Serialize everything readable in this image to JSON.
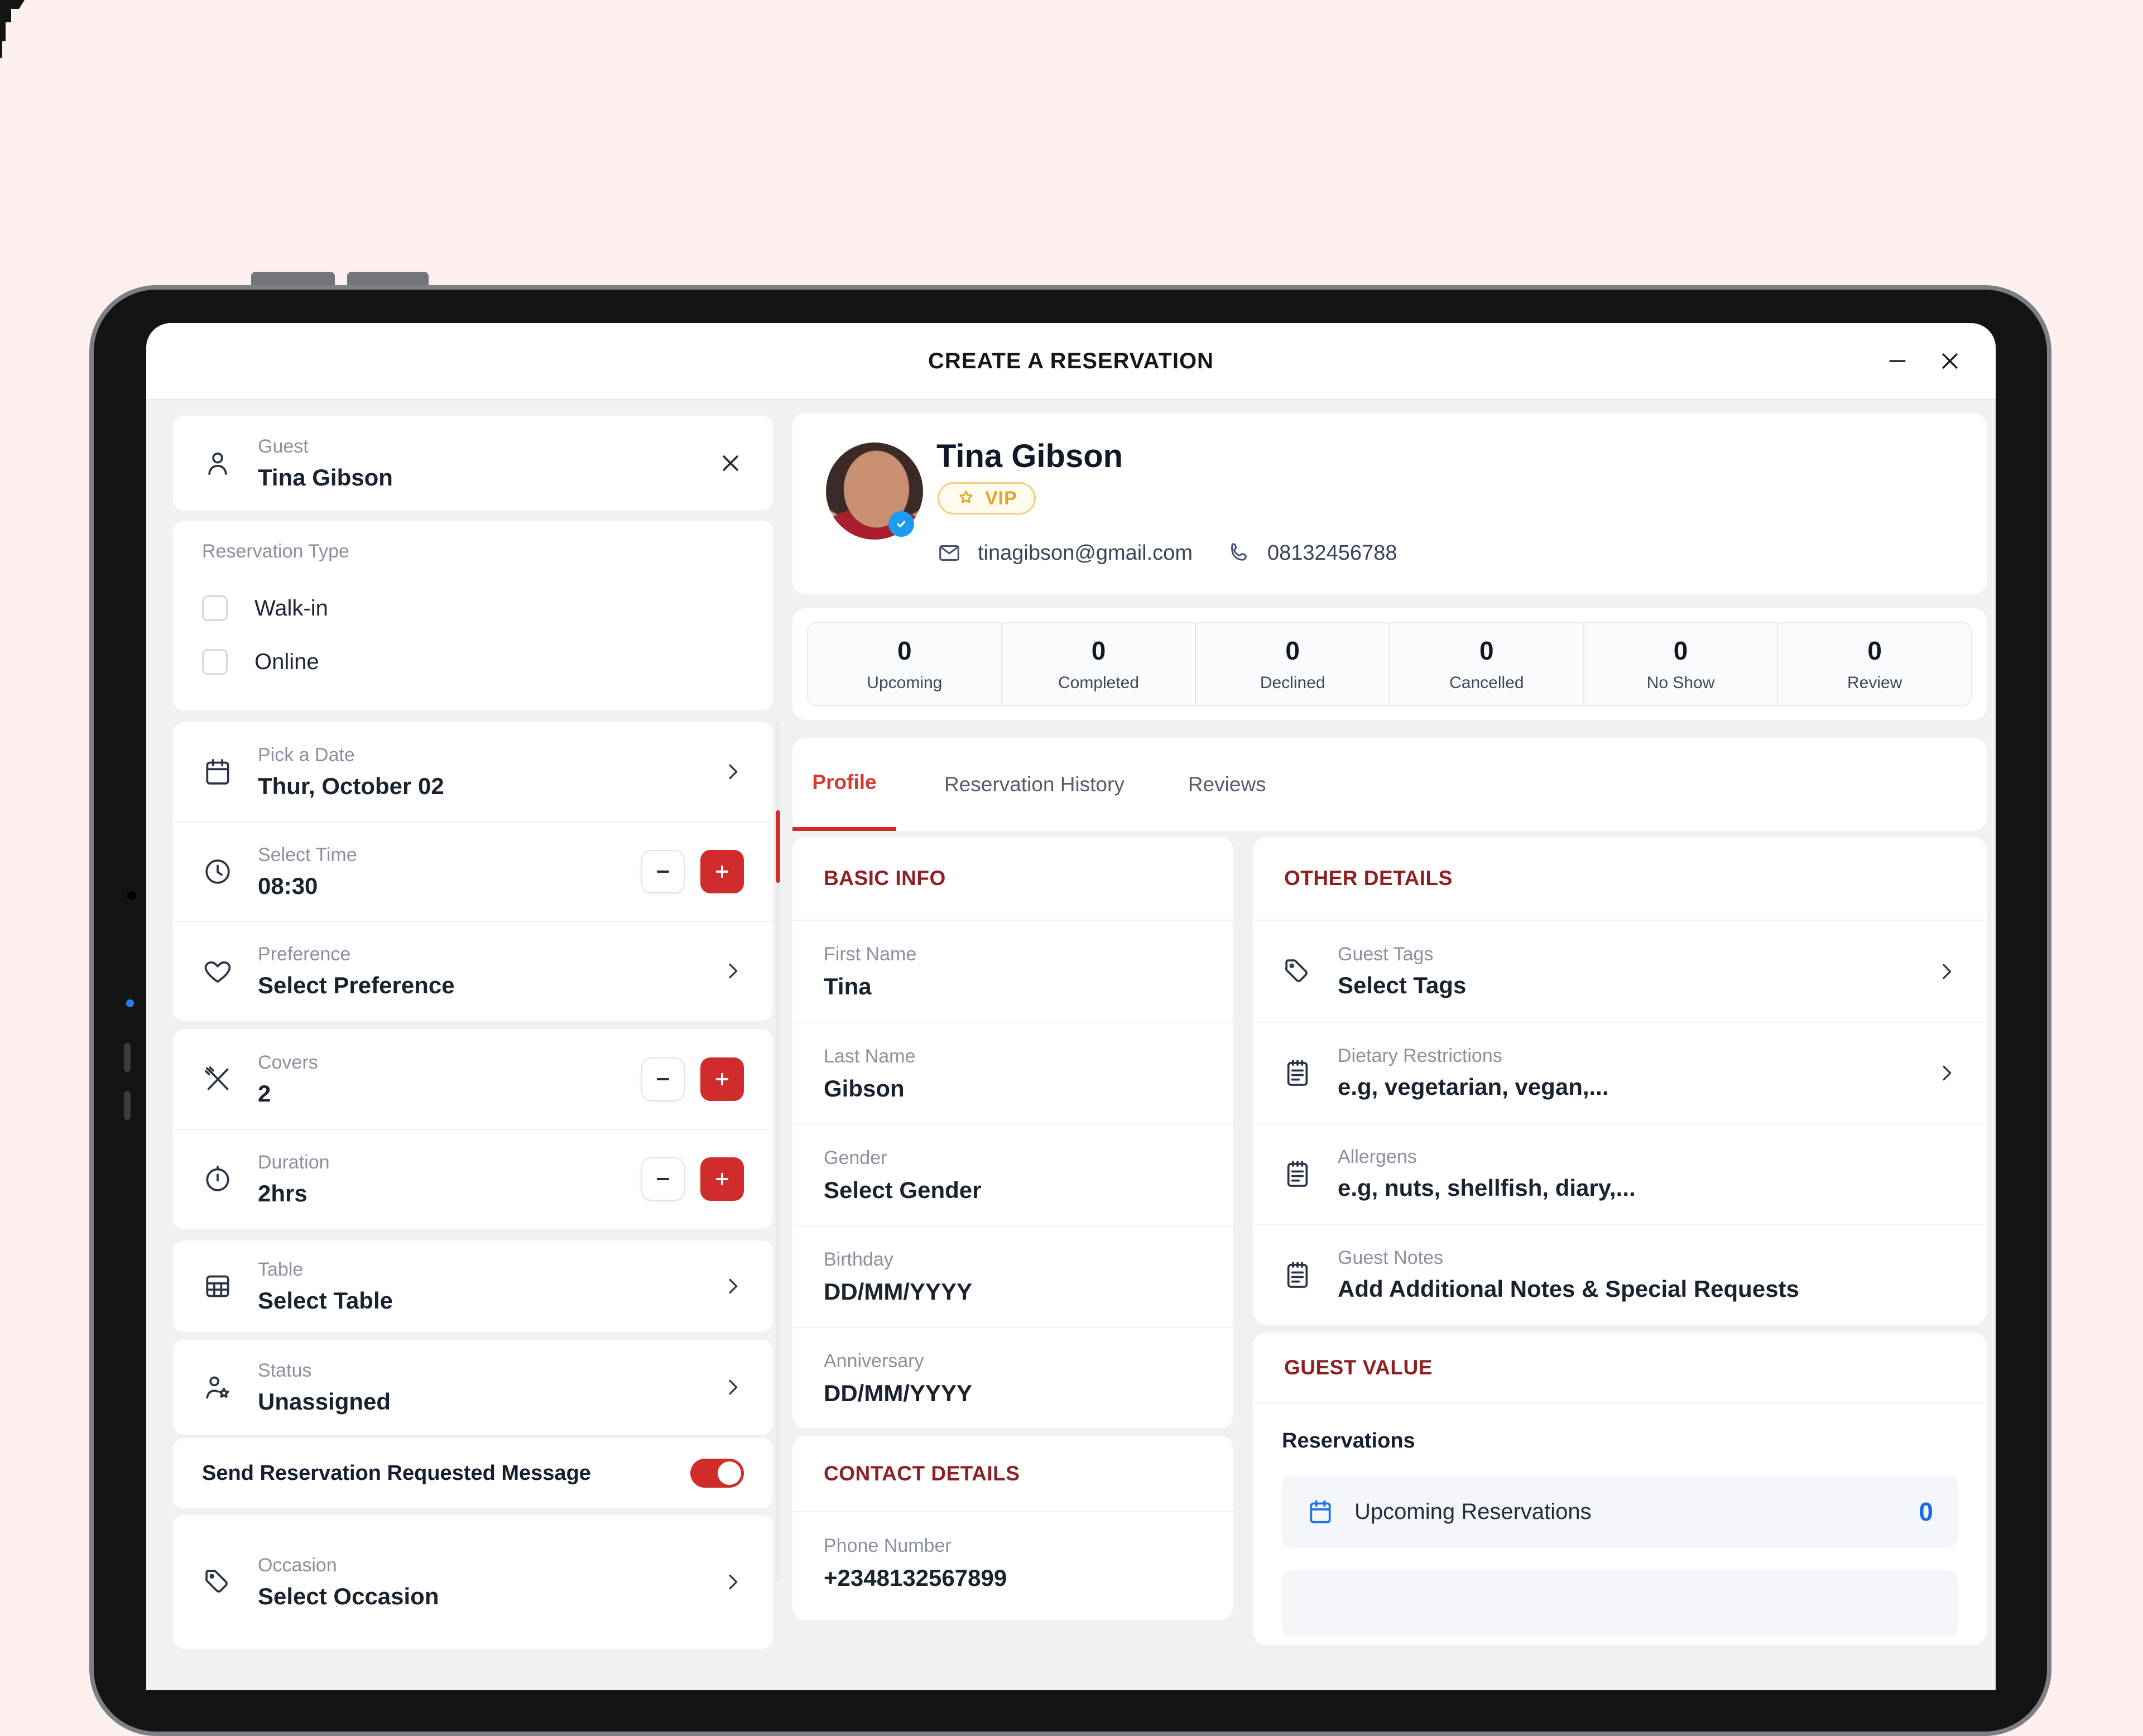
{
  "window": {
    "title": "CREATE A RESERVATION"
  },
  "sidebar": {
    "guest": {
      "label": "Guest",
      "value": "Tina Gibson"
    },
    "reservation_type": {
      "label": "Reservation Type",
      "options": [
        {
          "label": "Walk-in",
          "checked": false
        },
        {
          "label": "Online",
          "checked": false
        }
      ]
    },
    "date": {
      "label": "Pick a Date",
      "value": "Thur, October 02"
    },
    "time": {
      "label": "Select Time",
      "value": "08:30"
    },
    "preference": {
      "label": "Preference",
      "value": "Select Preference"
    },
    "covers": {
      "label": "Covers",
      "value": "2"
    },
    "duration": {
      "label": "Duration",
      "value": "2hrs"
    },
    "table": {
      "label": "Table",
      "value": "Select Table"
    },
    "status": {
      "label": "Status",
      "value": "Unassigned"
    },
    "toggle": {
      "label": "Send Reservation Requested Message",
      "on": true
    },
    "occasion": {
      "label": "Occasion",
      "value": "Select Occasion"
    }
  },
  "profile": {
    "name": "Tina Gibson",
    "badge": "VIP",
    "email": "tinagibson@gmail.com",
    "phone": "08132456788",
    "stats": [
      {
        "value": "0",
        "label": "Upcoming"
      },
      {
        "value": "0",
        "label": "Completed"
      },
      {
        "value": "0",
        "label": "Declined"
      },
      {
        "value": "0",
        "label": "Cancelled"
      },
      {
        "value": "0",
        "label": "No Show"
      },
      {
        "value": "0",
        "label": "Review"
      }
    ],
    "tabs": [
      {
        "label": "Profile",
        "active": true
      },
      {
        "label": "Reservation History",
        "active": false
      },
      {
        "label": "Reviews",
        "active": false
      }
    ]
  },
  "basic_info": {
    "title": "BASIC INFO",
    "rows": [
      {
        "label": "First Name",
        "value": "Tina"
      },
      {
        "label": "Last Name",
        "value": "Gibson"
      },
      {
        "label": "Gender",
        "value": "Select Gender"
      },
      {
        "label": "Birthday",
        "value": "DD/MM/YYYY"
      },
      {
        "label": "Anniversary",
        "value": "DD/MM/YYYY"
      }
    ]
  },
  "contact_details": {
    "title": "CONTACT DETAILS",
    "rows": [
      {
        "label": "Phone Number",
        "value": "+2348132567899"
      }
    ]
  },
  "other_details": {
    "title": "OTHER DETAILS",
    "rows": [
      {
        "label": "Guest Tags",
        "value": "Select Tags"
      },
      {
        "label": "Dietary Restrictions",
        "value": "e.g, vegetarian, vegan,..."
      },
      {
        "label": "Allergens",
        "value": "e.g, nuts, shellfish, diary,..."
      },
      {
        "label": "Guest Notes",
        "value": "Add Additional Notes & Special Requests"
      }
    ]
  },
  "guest_value": {
    "title": "GUEST VALUE",
    "subtitle": "Reservations",
    "rows": [
      {
        "label": "Upcoming Reservations",
        "value": "0"
      }
    ]
  },
  "colors": {
    "accent_red": "#d02c2c",
    "section_maroon": "#8e2023",
    "tab_active_red": "#d9382f",
    "link_blue": "#1668e3",
    "verified_blue": "#1d9bf0",
    "vip_gold": "#dfa32f",
    "page_pink": "#fdf0ee"
  }
}
